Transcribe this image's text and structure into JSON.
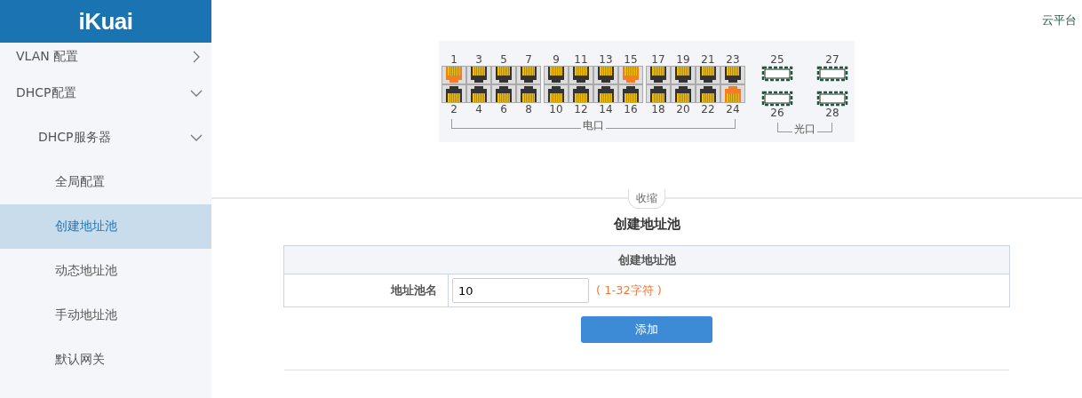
{
  "header": {
    "logo": "iKuai"
  },
  "sidebar": {
    "items": [
      {
        "label": "VLAN 配置",
        "expanded": false,
        "selected": false
      },
      {
        "label": "DHCP配置",
        "expanded": true,
        "selected": false,
        "children": [
          {
            "label": "DHCP服务器",
            "expanded": true,
            "selected": false,
            "children": [
              {
                "label": "全局配置",
                "selected": false
              },
              {
                "label": "创建地址池",
                "selected": true
              },
              {
                "label": "动态地址池",
                "selected": false
              },
              {
                "label": "手动地址池",
                "selected": false
              },
              {
                "label": "默认网关",
                "selected": false
              }
            ]
          }
        ]
      }
    ]
  },
  "top_link": "云平台",
  "switch_panel": {
    "electrical_label": "电口",
    "optical_label": "光口",
    "electrical_ports": [
      {
        "number": "1",
        "active": true
      },
      {
        "number": "2",
        "active": false
      },
      {
        "number": "3",
        "active": false
      },
      {
        "number": "4",
        "active": false
      },
      {
        "number": "5",
        "active": false
      },
      {
        "number": "6",
        "active": false
      },
      {
        "number": "7",
        "active": false
      },
      {
        "number": "8",
        "active": false
      },
      {
        "number": "9",
        "active": false
      },
      {
        "number": "10",
        "active": false
      },
      {
        "number": "11",
        "active": false
      },
      {
        "number": "12",
        "active": false
      },
      {
        "number": "13",
        "active": false
      },
      {
        "number": "14",
        "active": false
      },
      {
        "number": "15",
        "active": true
      },
      {
        "number": "16",
        "active": false
      },
      {
        "number": "17",
        "active": false
      },
      {
        "number": "18",
        "active": false
      },
      {
        "number": "19",
        "active": false
      },
      {
        "number": "20",
        "active": false
      },
      {
        "number": "21",
        "active": false
      },
      {
        "number": "22",
        "active": false
      },
      {
        "number": "23",
        "active": false
      },
      {
        "number": "24",
        "active": true
      }
    ],
    "optical_ports": [
      {
        "number": "25"
      },
      {
        "number": "26"
      },
      {
        "number": "27"
      },
      {
        "number": "28"
      }
    ]
  },
  "collapse_button": "收缩",
  "page_title": "创建地址池",
  "form": {
    "header": "创建地址池",
    "fields": [
      {
        "label": "地址池名",
        "value": "10",
        "hint": "( 1-32字符 )"
      }
    ],
    "submit": "添加"
  }
}
